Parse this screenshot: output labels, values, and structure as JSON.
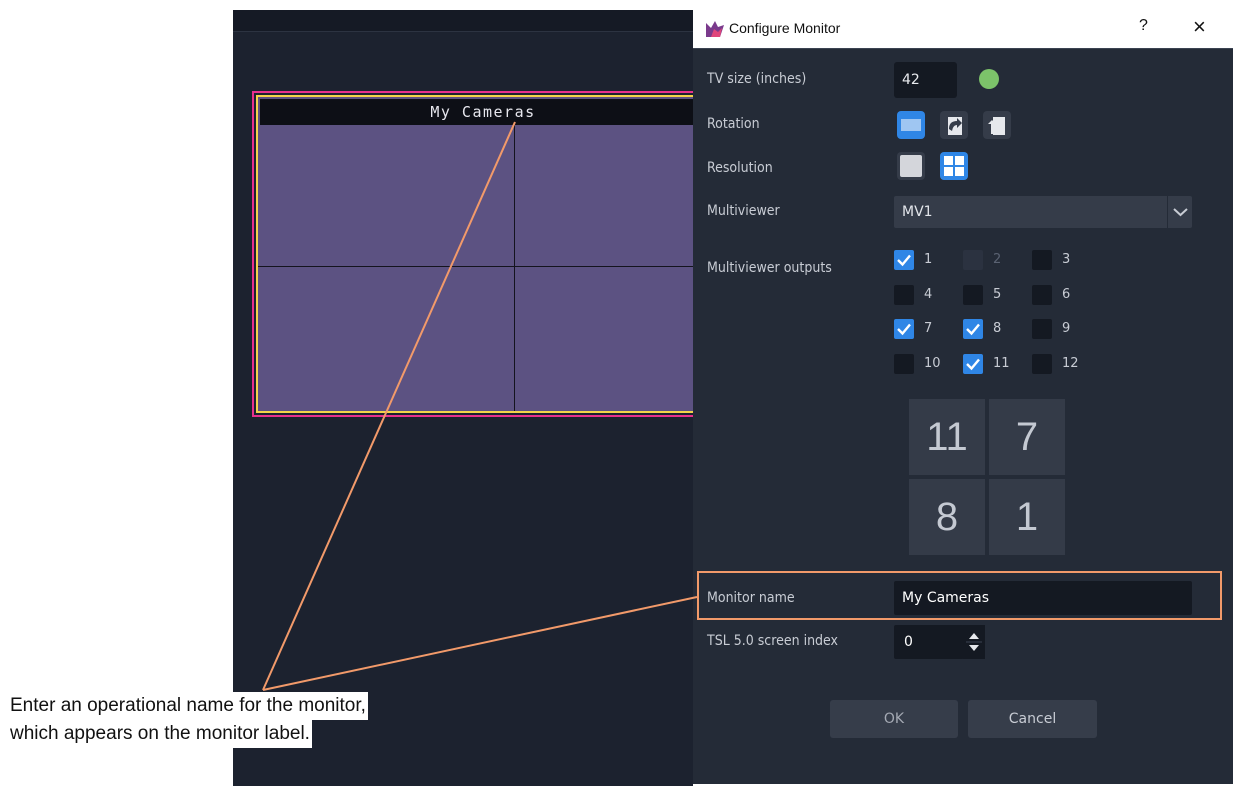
{
  "monitor_preview": {
    "title": "My Cameras"
  },
  "dialog": {
    "title": "Configure Monitor",
    "help_label": "?",
    "close_label": "×",
    "tv_size": {
      "label": "TV size (inches)",
      "value": "42",
      "status_color": "#7cc36a"
    },
    "rotation": {
      "label": "Rotation",
      "options": [
        "landscape-icon",
        "rotate-right-icon",
        "rotate-left-icon"
      ],
      "selected": "landscape-icon"
    },
    "resolution": {
      "label": "Resolution",
      "options": [
        "single-resolution-icon",
        "quad-resolution-icon"
      ],
      "selected": "quad-resolution-icon"
    },
    "multiviewer": {
      "label": "Multiviewer",
      "value": "MV1"
    },
    "outputs": {
      "label": "Multiviewer outputs",
      "items": [
        {
          "label": "1",
          "checked": true,
          "enabled": true
        },
        {
          "label": "2",
          "checked": false,
          "enabled": false
        },
        {
          "label": "3",
          "checked": false,
          "enabled": true
        },
        {
          "label": "4",
          "checked": false,
          "enabled": true
        },
        {
          "label": "5",
          "checked": false,
          "enabled": true
        },
        {
          "label": "6",
          "checked": false,
          "enabled": true
        },
        {
          "label": "7",
          "checked": true,
          "enabled": true
        },
        {
          "label": "8",
          "checked": true,
          "enabled": true
        },
        {
          "label": "9",
          "checked": false,
          "enabled": true
        },
        {
          "label": "10",
          "checked": false,
          "enabled": true
        },
        {
          "label": "11",
          "checked": true,
          "enabled": true
        },
        {
          "label": "12",
          "checked": false,
          "enabled": true
        }
      ]
    },
    "layout_cells": [
      "11",
      "7",
      "8",
      "1"
    ],
    "monitor_name": {
      "label": "Monitor name",
      "value": "My Cameras"
    },
    "tsl_index": {
      "label": "TSL 5.0 screen index",
      "value": "0"
    },
    "ok_label": "OK",
    "cancel_label": "Cancel"
  },
  "callout": {
    "line1": "Enter an operational name for the monitor,",
    "line2": "which appears on the monitor label.",
    "color": "#f29a6a"
  },
  "colors": {
    "accent": "#2f86e6",
    "dialog_bg": "#242b37",
    "monitor_fill": "#5c5282",
    "monitor_border": "#e8308c"
  }
}
